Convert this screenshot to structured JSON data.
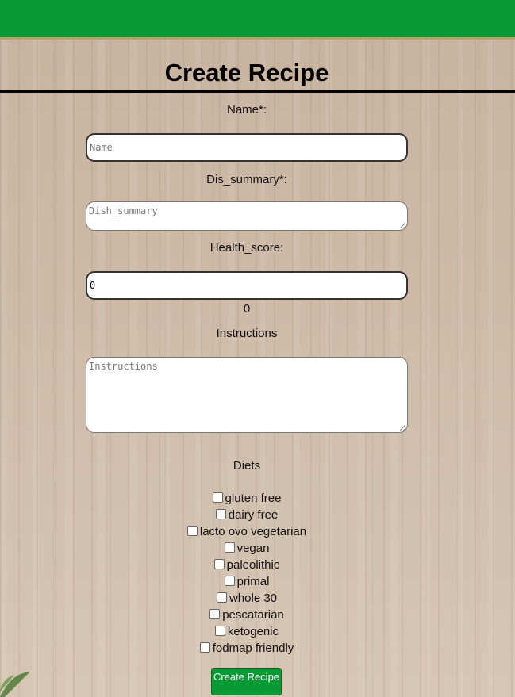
{
  "page": {
    "title": "Create Recipe"
  },
  "form": {
    "name": {
      "label": "Name*:",
      "placeholder": "Name",
      "value": ""
    },
    "dish_summary": {
      "label": "Dis_summary*:",
      "placeholder": "Dish_summary",
      "value": ""
    },
    "health_score": {
      "label": "Health_score:",
      "value": "0",
      "display": "0"
    },
    "instructions": {
      "label": "Instructions",
      "placeholder": "Instructions",
      "value": ""
    },
    "diets": {
      "label": "Diets",
      "options": [
        "gluten free",
        "dairy free",
        "lacto ovo vegetarian",
        "vegan",
        "paleolithic",
        "primal",
        "whole 30",
        "pescatarian",
        "ketogenic",
        "fodmap friendly"
      ]
    },
    "submit_label": "Create Recipe"
  },
  "colors": {
    "header": "#0a9a35",
    "button": "#0a9a35"
  }
}
